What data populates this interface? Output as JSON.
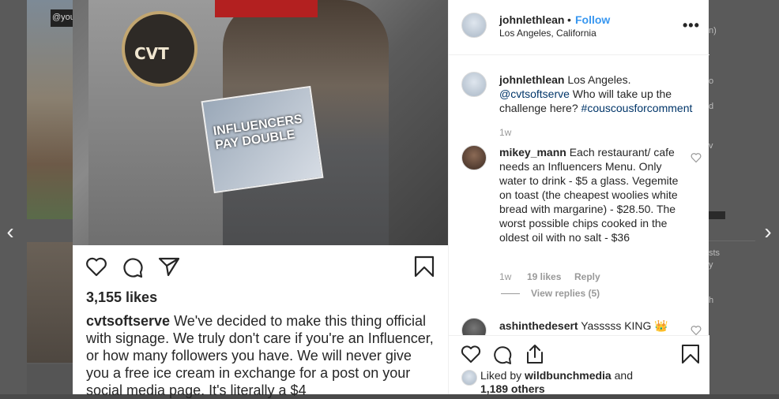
{
  "background": {
    "thumb_tag": "@you",
    "fragments": [
      "n)",
      "o",
      "d",
      "v",
      "sts",
      "y",
      "h"
    ]
  },
  "nav": {
    "prev_glyph": "‹",
    "next_glyph": "›"
  },
  "photo": {
    "logo_text": "CVT",
    "book_text": "INFLUENCERS PAY DOUBLE"
  },
  "post": {
    "likes": "3,155 likes",
    "caption_user": "cvtsoftserve",
    "caption_text": "We've decided to make this thing official with signage. We truly don't care if you're an Influencer, or how many followers you have. We will never give you a free ice cream in exchange for a post on your social media page. It's literally a $4"
  },
  "header": {
    "username": "johnlethlean",
    "separator": "•",
    "follow_label": "Follow",
    "location": "Los Angeles, California",
    "more_label": "•••"
  },
  "comments": [
    {
      "user": "johnlethlean",
      "text_before": "Los Angeles.",
      "mention": "@cvtsoftserve",
      "text_middle": "Who will take up the challenge here?",
      "hashtag": "#couscousforcomment",
      "time": "1w"
    },
    {
      "user": "mikey_mann",
      "text": "Each restaurant/ cafe needs an Influencers Menu. Only water to drink - $5 a glass. Vegemite on toast (the cheapest woolies white bread with margarine) - $28.50. The worst possible chips cooked in the oldest oil with no salt - $36",
      "time": "1w",
      "likes": "19 likes",
      "reply_label": "Reply",
      "view_replies": "View replies (5)"
    },
    {
      "user": "ashinthedesert",
      "text": "Yasssss KING 👑"
    }
  ],
  "footer": {
    "liked_prefix": "Liked by",
    "liked_user": "wildbunchmedia",
    "liked_suffix": "and",
    "others": "1,189 others"
  }
}
